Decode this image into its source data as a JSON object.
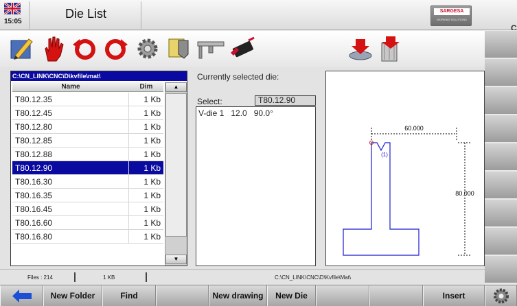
{
  "header": {
    "time": "15:05",
    "title": "Die List",
    "logo_brand": "SARGESA",
    "logo_tagline": "WORKING SOLUTIONS",
    "edge_char": "C"
  },
  "toolbar": {
    "icons": [
      "edit-icon",
      "stop-hand-icon",
      "rotate-left-icon",
      "rotate-right-icon",
      "gear-settings-icon",
      "tool-clamp-icon",
      "caliper-icon",
      "usb-drive-icon",
      "import-icon",
      "delete-bin-icon"
    ]
  },
  "file_list": {
    "path": "C:\\CN_LINK\\CNC\\D\\kvfile\\mat\\",
    "col_name": "Name",
    "col_dim": "Dim",
    "rows": [
      {
        "name": "T80.12.35",
        "dim": "1 Kb"
      },
      {
        "name": "T80.12.45",
        "dim": "1 Kb"
      },
      {
        "name": "T80.12.80",
        "dim": "1 Kb"
      },
      {
        "name": "T80.12.85",
        "dim": "1 Kb"
      },
      {
        "name": "T80.12.88",
        "dim": "1 Kb"
      },
      {
        "name": "T80.12.90",
        "dim": "1 Kb",
        "selected": true
      },
      {
        "name": "T80.16.30",
        "dim": "1 Kb"
      },
      {
        "name": "T80.16.35",
        "dim": "1 Kb"
      },
      {
        "name": "T80.16.45",
        "dim": "1 Kb"
      },
      {
        "name": "T80.16.60",
        "dim": "1 Kb"
      },
      {
        "name": "T80.16.80",
        "dim": "1 Kb"
      }
    ]
  },
  "details": {
    "current_label": "Currently selected die:",
    "select_label": "Select:",
    "select_value": "T80.12.90",
    "die_row": [
      "V-die 1",
      "12.0",
      "90.0°"
    ]
  },
  "preview": {
    "width_label": "60.000",
    "height_label": "80.000",
    "vee_label": "(1)"
  },
  "status": {
    "files": "Files : 214",
    "size": "1 KB",
    "path": "C:\\CN_LINK\\CNC\\D\\Kvfile\\Mat\\"
  },
  "bottom": {
    "new_folder": "New Folder",
    "find": "Find",
    "new_drawing": "New drawing",
    "new_die": "New Die",
    "insert": "Insert"
  },
  "colors": {
    "selection": "#0a0aa0",
    "die_outline": "#1a1ad0",
    "back_arrow": "#1a4fd6"
  }
}
